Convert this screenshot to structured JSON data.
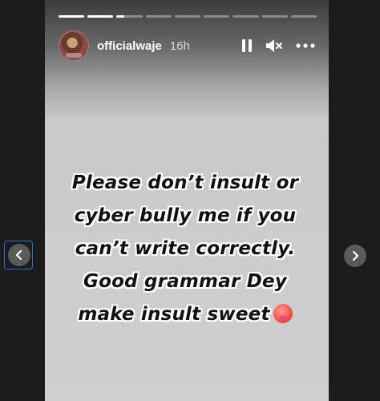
{
  "story": {
    "username": "officialwaje",
    "time": "16h",
    "segments_total": 9,
    "segments_progress": [
      1,
      1,
      0.3,
      0,
      0,
      0,
      0,
      0,
      0
    ],
    "text_lines": [
      "Please don’t insult or",
      "cyber bully me if you",
      "can’t write correctly.",
      "Good grammar Dey",
      "make insult sweet"
    ],
    "emoji_icon": "hot-face-emoji-icon"
  },
  "controls": {
    "pause_icon": "pause-icon",
    "mute_icon": "mute-icon",
    "more_icon": "more-options-icon"
  },
  "nav": {
    "prev_icon": "chevron-left-icon",
    "next_icon": "chevron-right-icon"
  },
  "colors": {
    "background": "#1b1b1b",
    "story_bg": "#cfcfcf",
    "text": "#111111",
    "focus_outline": "#2f6fd6"
  }
}
